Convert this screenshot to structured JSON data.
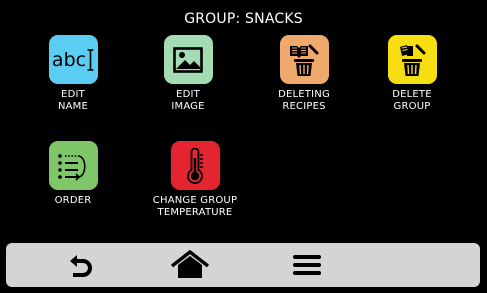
{
  "header": {
    "title": "GROUP: SNACKS"
  },
  "tiles": [
    {
      "label": "EDIT\nNAME",
      "icon": "abc-text-cursor-icon",
      "icon_text": "abc",
      "color": "#5bcdf2"
    },
    {
      "label": "EDIT\nIMAGE",
      "icon": "image-icon",
      "color": "#a6dcb3"
    },
    {
      "label": "DELETING\nRECIPES",
      "icon": "delete-recipes-icon",
      "color": "#f0a96c"
    },
    {
      "label": "DELETE\nGROUP",
      "icon": "delete-group-icon",
      "color": "#f6de10"
    },
    {
      "label": "ORDER",
      "icon": "order-list-icon",
      "color": "#7ec669"
    },
    {
      "label": "CHANGE GROUP\nTEMPERATURE",
      "icon": "thermometer-icon",
      "color": "#e52431"
    }
  ],
  "bottom_nav": {
    "items": [
      "back-icon",
      "home-icon",
      "menu-icon"
    ],
    "bar_color": "#d4d4d4"
  }
}
